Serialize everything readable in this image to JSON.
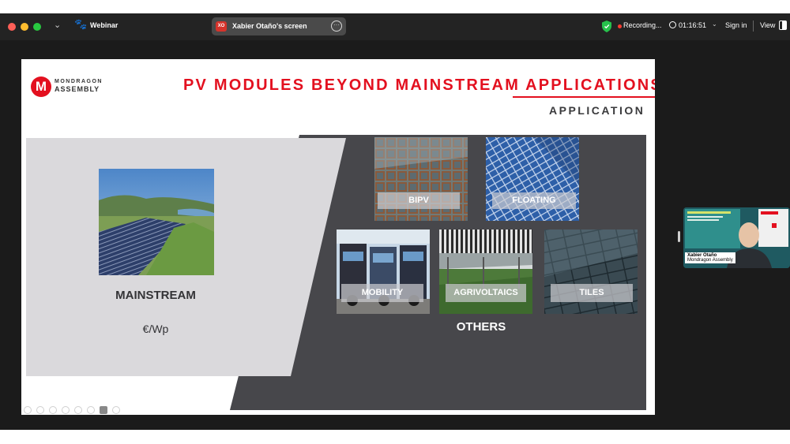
{
  "window": {
    "app_title": "Webinar",
    "share_badge": "XO",
    "share_label": "Xabier Otaño's screen",
    "recording_label": "Recording...",
    "timer": "01:16:51",
    "sign_in": "Sign in",
    "view": "View"
  },
  "slide": {
    "logo_line1": "MONDRAGON",
    "logo_line2": "ASSEMBLY",
    "logo_mark": "M",
    "title": "PV MODULES BEYOND MAINSTREAM APPLICATIONS",
    "subtitle": "APPLICATION",
    "mainstream_label": "MAINSTREAM",
    "mainstream_unit": "€/Wp",
    "others_label": "OTHERS",
    "tiles": [
      {
        "label": "BIPV"
      },
      {
        "label": "FLOATING"
      },
      {
        "label": "MOBILITY"
      },
      {
        "label": "AGRIVOLTAICS"
      },
      {
        "label": "TILES"
      }
    ]
  },
  "participant": {
    "name": "Xabier Otaño",
    "org": "Mondragon Assembly"
  },
  "colors": {
    "brand_red": "#e3101f",
    "dark_panel": "#47474b",
    "light_panel": "#dad9dc",
    "recording_dot": "#ff3b30"
  },
  "icons": {
    "window_controls": [
      "close-icon",
      "minimize-icon",
      "maximize-icon"
    ],
    "meeting": "paw-icon",
    "share_options": "more-icon",
    "security": "shield-icon",
    "timer": "clock-icon",
    "view": "view-layout-icon"
  }
}
